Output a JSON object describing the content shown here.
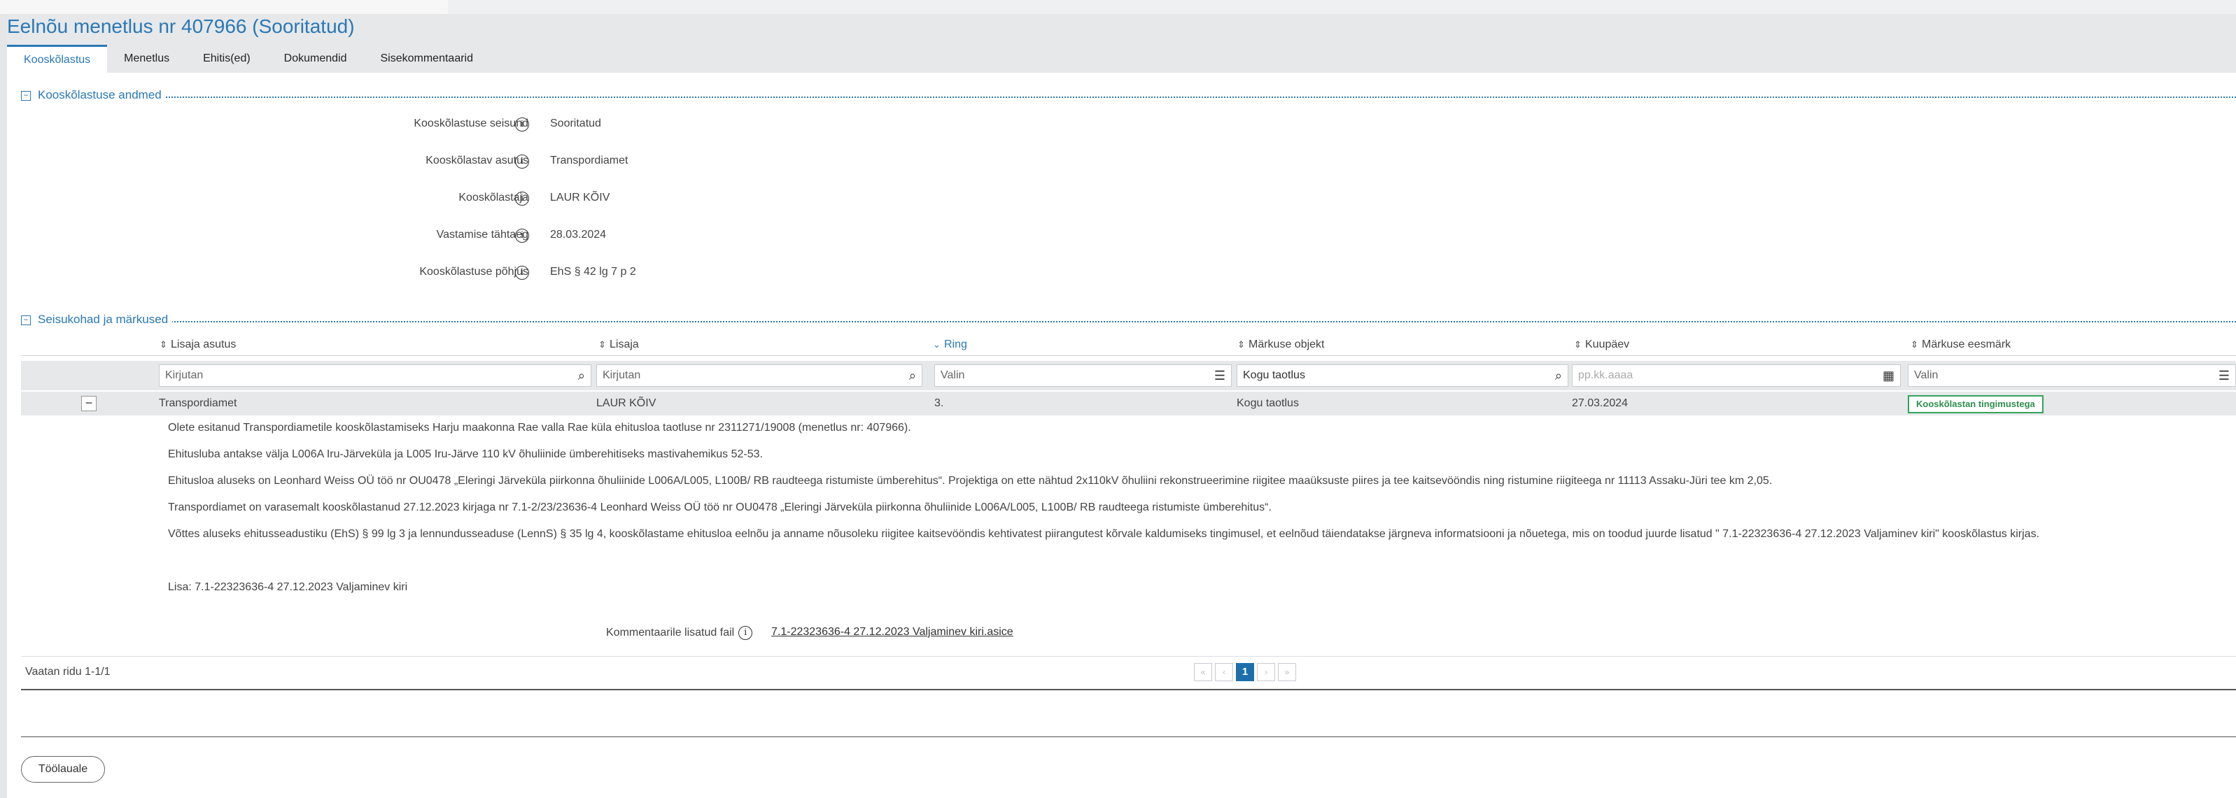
{
  "page": {
    "title": "Eelnõu menetlus nr 407966 (Sooritatud)"
  },
  "tabs": [
    {
      "label": "Kooskõlastus",
      "active": true
    },
    {
      "label": "Menetlus",
      "active": false
    },
    {
      "label": "Ehitis(ed)",
      "active": false
    },
    {
      "label": "Dokumendid",
      "active": false
    },
    {
      "label": "Sisekommentaarid",
      "active": false
    }
  ],
  "details_section": {
    "title": "Kooskõlastuse andmed",
    "fields": [
      {
        "label": "Kooskõlastuse seisund",
        "value": "Sooritatud"
      },
      {
        "label": "Kooskõlastav asutus",
        "value": "Transpordiamet"
      },
      {
        "label": "Kooskõlastaja",
        "value": "LAUR KÕIV"
      },
      {
        "label": "Vastamise tähtaeg",
        "value": "28.03.2024"
      },
      {
        "label": "Kooskõlastuse põhjus",
        "value": "EhS § 42 lg 7 p 2"
      }
    ]
  },
  "positions_section": {
    "title": "Seisukohad ja märkused",
    "columns": [
      {
        "label": "Lisaja asutus",
        "sorted": false
      },
      {
        "label": "Lisaja",
        "sorted": false
      },
      {
        "label": "Ring",
        "sorted": true
      },
      {
        "label": "Märkuse objekt",
        "sorted": false
      },
      {
        "label": "Kuupäev",
        "sorted": false
      },
      {
        "label": "Märkuse eesmärk",
        "sorted": false
      }
    ],
    "filters": [
      {
        "value": "Kirjutan",
        "icon": "search-icon"
      },
      {
        "value": "Kirjutan",
        "icon": "search-icon"
      },
      {
        "value": "Valin",
        "icon": "list-icon"
      },
      {
        "value": "Kogu taotlus",
        "icon": "search-icon"
      },
      {
        "placeholder": "pp.kk.aaaa",
        "icon": "calendar-icon"
      },
      {
        "value": "Valin",
        "icon": "list-icon"
      }
    ],
    "row": {
      "institution": "Transpordiamet",
      "author": "LAUR KÕIV",
      "round": "3.",
      "object": "Kogu taotlus",
      "date": "27.03.2024",
      "purpose": "Kooskõlastan tingimustega",
      "purpose_color": "#35a35a"
    },
    "comment": [
      "Olete esitanud Transpordiametile kooskõlastamiseks Harju maakonna Rae valla Rae küla ehitusloa taotluse nr 2311271/19008 (menetlus nr: 407966).",
      "Ehitusluba antakse välja L006A Iru-Järveküla ja L005 Iru-Järve 110 kV õhuliinide ümberehitiseks mastivahemikus 52-53.",
      "Ehitusloa aluseks on Leonhard Weiss OÜ töö nr OU0478 „Eleringi Järveküla piirkonna õhuliinide L006A/L005, L100B/ RB raudteega ristumiste ümberehitus“. Projektiga on ette nähtud 2x110kV õhuliini rekonstrueerimine riigitee maaüksuste piires ja tee kaitsevööndis ning ristumine riigiteega nr 11113 Assaku-Jüri tee km 2,05.",
      "Transpordiamet on varasemalt kooskõlastanud 27.12.2023 kirjaga nr 7.1-2/23/23636-4 Leonhard Weiss OÜ töö nr OU0478 „Eleringi Järveküla piirkonna õhuliinide L006A/L005, L100B/ RB raudteega ristumiste ümberehitus“.",
      "Võttes aluseks ehitusseadustiku (EhS) § 99 lg 3 ja lennundusseaduse (LennS) § 35 lg 4, kooskõlastame ehitusloa eelnõu ja anname nõusoleku riigitee kaitsevööndis kehtivatest piirangutest kõrvale kaldumiseks tingimusel, et eelnõud täiendatakse järgneva informatsiooni ja nõuetega, mis on toodud juurde lisatud \" 7.1-22323636-4 27.12.2023 Valjaminev kiri\" kooskõlastus kirjas.",
      "Lisa: 7.1-22323636-4 27.12.2023 Valjaminev kiri"
    ],
    "attachment_label": "Kommentaarile lisatud fail",
    "attachment_file": "7.1-22323636-4 27.12.2023 Valjaminev kiri.asice"
  },
  "pagination": {
    "summary": "Vaatan ridu 1-1/1",
    "first": "«",
    "prev": "‹",
    "current": "1",
    "next": "›",
    "last": "»"
  },
  "footer": {
    "back_label": "Töölauale"
  }
}
